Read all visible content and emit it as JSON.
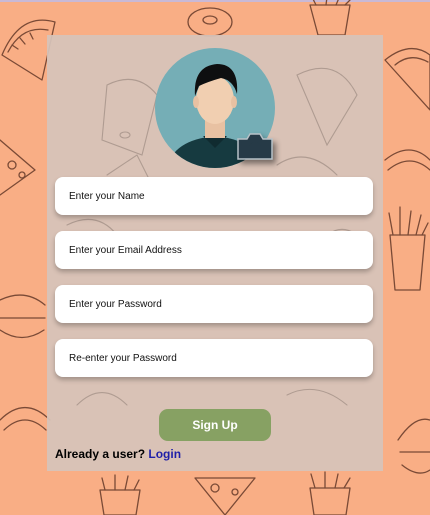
{
  "form": {
    "name_placeholder": "Enter your Name",
    "email_placeholder": "Enter your Email Address",
    "password_placeholder": "Enter your Password",
    "confirm_placeholder": "Re-enter your Password",
    "signup_label": "Sign Up",
    "already_user_text": "Already a user?",
    "login_label": "Login"
  },
  "icons": {
    "avatar": "user-avatar-icon",
    "camera": "camera-icon"
  },
  "colors": {
    "page_background": "#f9ae85",
    "card_background": "#d6c4ba",
    "avatar_background": "#75aeb6",
    "signup_button": "#87a163",
    "login_link": "#1f1fa8"
  }
}
